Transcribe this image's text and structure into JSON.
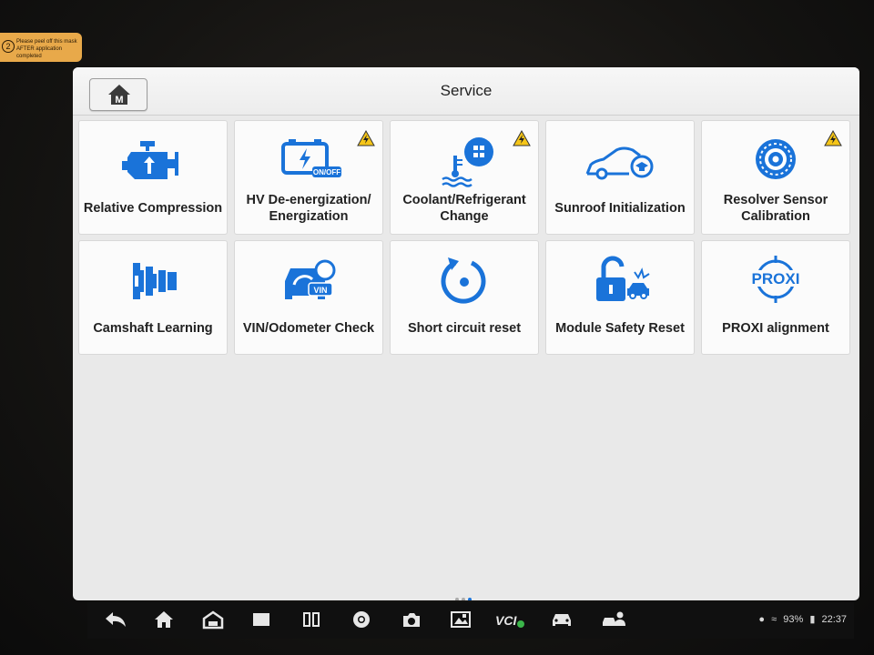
{
  "sticker": {
    "number": "2",
    "line1": "Please peel off this mask",
    "line2": "AFTER application completed"
  },
  "header": {
    "title": "Service",
    "home_label": "M"
  },
  "colors": {
    "accent": "#1a73d9",
    "warning": "#f5c518",
    "tile_bg": "#fbfbfb",
    "screen_bg": "#e9e9e9"
  },
  "tiles": [
    {
      "label": "Relative Compression",
      "icon": "engine-icon",
      "warning": false
    },
    {
      "label": "HV De-energization/ Energization",
      "icon": "battery-icon",
      "badge": "ON/OFF",
      "warning": true
    },
    {
      "label": "Coolant/Refrigerant Change",
      "icon": "coolant-icon",
      "warning": true
    },
    {
      "label": "Sunroof Initialization",
      "icon": "car-sunroof-icon",
      "warning": false
    },
    {
      "label": "Resolver Sensor Calibration",
      "icon": "gear-sensor-icon",
      "warning": true
    },
    {
      "label": "Camshaft Learning",
      "icon": "camshaft-icon",
      "warning": false
    },
    {
      "label": "VIN/Odometer Check",
      "icon": "vin-icon",
      "badge": "VIN",
      "warning": false
    },
    {
      "label": "Short circuit reset",
      "icon": "reset-icon",
      "warning": false
    },
    {
      "label": "Module Safety Reset",
      "icon": "lock-crash-icon",
      "warning": false
    },
    {
      "label": "PROXI alignment",
      "icon": "proxi-icon",
      "badge": "PROXI",
      "warning": false
    }
  ],
  "pager": {
    "pages": 3,
    "active": 3
  },
  "status": {
    "battery": "93%",
    "time": "22:37",
    "vci_label": "VCI"
  }
}
